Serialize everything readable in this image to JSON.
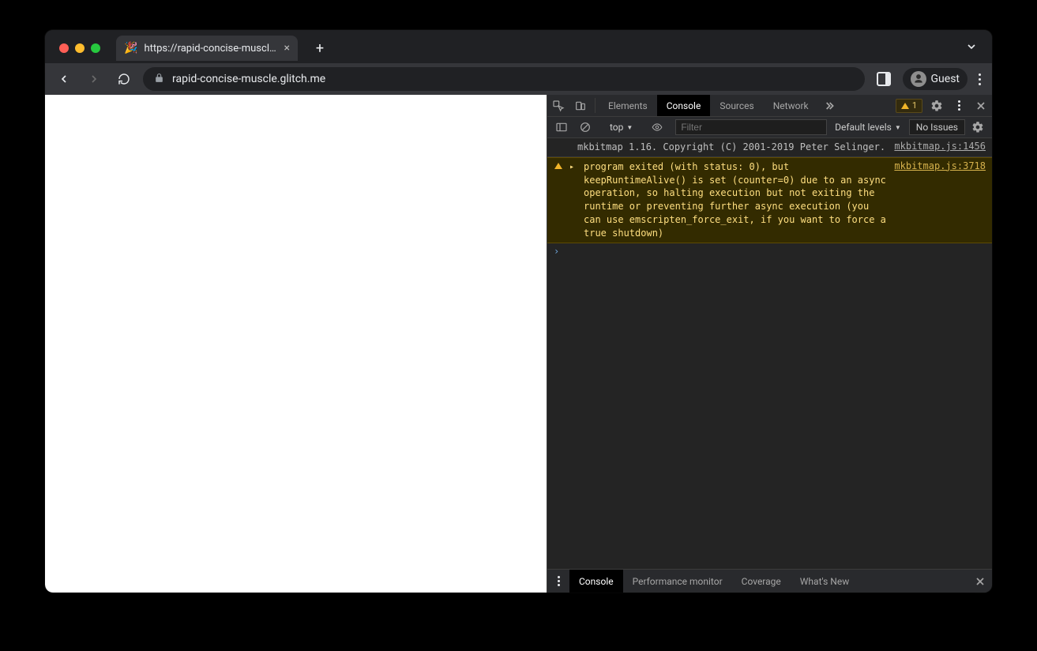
{
  "tab": {
    "favicon": "🎉",
    "title": "https://rapid-concise-muscle.g"
  },
  "addressbar": {
    "url_text": "rapid-concise-muscle.glitch.me",
    "profile_label": "Guest"
  },
  "devtools": {
    "tabs": {
      "elements": "Elements",
      "console": "Console",
      "sources": "Sources",
      "network": "Network"
    },
    "warning_chip_count": "1",
    "toolbar": {
      "context_selector": "top",
      "filter_placeholder": "Filter",
      "levels_label": "Default levels",
      "no_issues_label": "No Issues"
    },
    "console_log": {
      "msg": "mkbitmap 1.16. Copyright (C) 2001-2019 Peter Selinger.",
      "src": "mkbitmap.js:1456"
    },
    "console_warn": {
      "msg": "program exited (with status: 0), but keepRuntimeAlive() is set (counter=0) due to an async operation, so halting execution but not exiting the runtime or preventing further async execution (you can use emscripten_force_exit, if you want to force a true shutdown)",
      "src": "mkbitmap.js:3718"
    },
    "drawer": {
      "tab_console": "Console",
      "tab_perfmon": "Performance monitor",
      "tab_coverage": "Coverage",
      "tab_whatsnew": "What's New"
    }
  }
}
